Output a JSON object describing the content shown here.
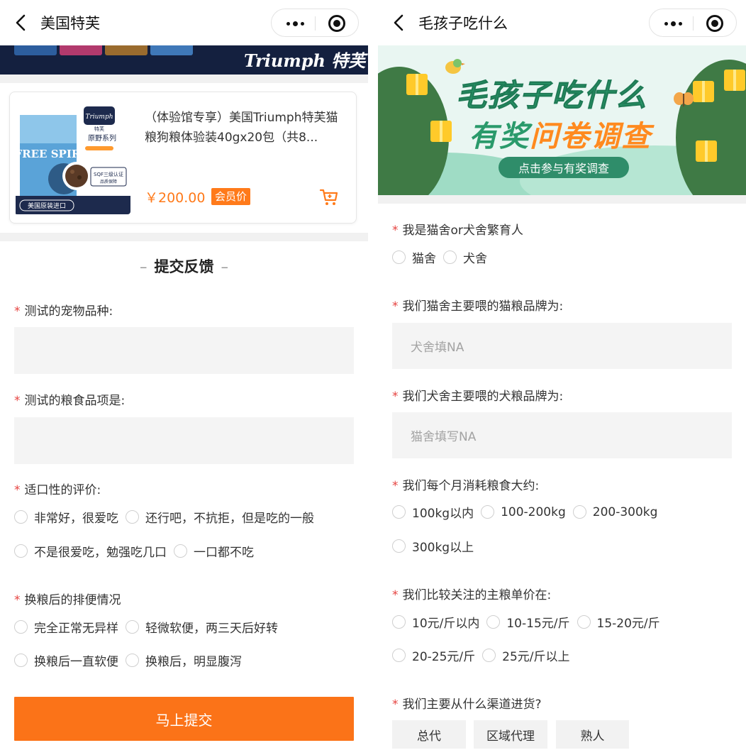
{
  "left": {
    "nav": {
      "title": "美国特芙"
    },
    "banner": {
      "brand": "Triumph 特芙"
    },
    "product": {
      "image_text": {
        "brand": "Triumph",
        "brand_cn": "特芙",
        "series": "原野系列",
        "product_line": "FREE SPIRIT",
        "cert": "SQF三级认证",
        "cert_sub": "品质保障",
        "origin": "美国原装进口"
      },
      "name": "（体验馆专享）美国Triumph特芙猫粮狗粮体验装40gx20包（共8...",
      "price": "￥200.00",
      "member_tag": "会员价"
    },
    "form": {
      "title": "提交反馈",
      "title_dash": "–",
      "q1": {
        "label": "测试的宠物品种:",
        "value": ""
      },
      "q2": {
        "label": "测试的粮食品项是:",
        "value": ""
      },
      "q3": {
        "label": "适口性的评价:",
        "options": [
          "非常好，很爱吃",
          "还行吧，不抗拒，但是吃的一般",
          "不是很爱吃，勉强吃几口",
          "一口都不吃"
        ]
      },
      "q4": {
        "label": "换粮后的排便情况",
        "options": [
          "完全正常无异样",
          "轻微软便，两三天后好转",
          "换粮后一直软便",
          "换粮后，明显腹泻"
        ]
      },
      "required_mark": "*",
      "submit_label": "马上提交"
    }
  },
  "right": {
    "nav": {
      "title": "毛孩子吃什么"
    },
    "banner": {
      "line1": "毛孩子吃什么",
      "line2_a": "有奖",
      "line2_b": "问卷调查",
      "cta": "点击参与有奖调查"
    },
    "form": {
      "required_mark": "*",
      "q1": {
        "label": "我是猫舍or犬舍繁育人",
        "options": [
          "猫舍",
          "犬舍"
        ]
      },
      "q2": {
        "label": "我们猫舍主要喂的猫粮品牌为:",
        "placeholder": "犬舍填NA"
      },
      "q3": {
        "label": "我们犬舍主要喂的犬粮品牌为:",
        "placeholder": "猫舍填写NA"
      },
      "q4": {
        "label": "我们每个月消耗粮食大约:",
        "options": [
          "100kg以内",
          "100-200kg",
          "200-300kg",
          "300kg以上"
        ]
      },
      "q5": {
        "label": "我们比较关注的主粮单价在:",
        "options": [
          "10元/斤以内",
          "10-15元/斤",
          "15-20元/斤",
          "20-25元/斤",
          "25元/斤以上"
        ]
      },
      "q6": {
        "label": "我们主要从什么渠道进货?",
        "options": [
          "总代",
          "区域代理",
          "熟人"
        ]
      }
    }
  },
  "colors": {
    "accent": "#fb7318",
    "required": "#e64340",
    "survey_green": "#2a9a6b"
  }
}
